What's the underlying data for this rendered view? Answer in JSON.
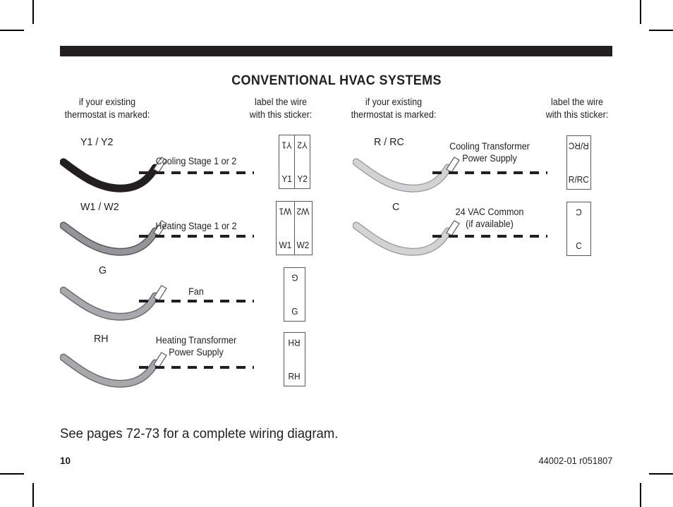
{
  "document": {
    "title": "CONVENTIONAL HVAC SYSTEMS",
    "page_number": "10",
    "doc_code": "44002-01 r051807",
    "footer_note": "See pages 72-73 for a complete wiring diagram."
  },
  "headers": {
    "left_marked": "if your existing\nthermostat is marked:",
    "left_marked_line1": "if your existing",
    "left_marked_line2": "thermostat is marked:",
    "left_sticker_line1": "label the wire",
    "left_sticker_line2": "with this sticker:",
    "right_marked_line1": "if your existing",
    "right_marked_line2": "thermostat is marked:",
    "right_sticker_line1": "label the wire",
    "right_sticker_line2": "with this sticker:"
  },
  "colors": {
    "ink": "#231f20",
    "wire_dark": "#231f20",
    "wire_gray": "#808285",
    "wire_light_gray": "#d1d3d4",
    "sticker_border": "#58595b"
  },
  "rows": [
    {
      "id": "y1y2",
      "terminal": "Y1 / Y2",
      "description_line1": "Cooling Stage 1 or 2",
      "description_line2": "",
      "wire_color": "dark",
      "sticker": {
        "cells": [
          {
            "top": "Y1",
            "bottom": "Y1"
          },
          {
            "top": "Y2",
            "bottom": "Y2"
          }
        ]
      }
    },
    {
      "id": "w1w2",
      "terminal": "W1 / W2",
      "description_line1": "Heating Stage 1 or 2",
      "description_line2": "",
      "wire_color": "gray",
      "sticker": {
        "cells": [
          {
            "top": "W1",
            "bottom": "W1"
          },
          {
            "top": "W2",
            "bottom": "W2"
          }
        ]
      }
    },
    {
      "id": "g",
      "terminal": "G",
      "description_line1": "Fan",
      "description_line2": "",
      "wire_color": "gray",
      "sticker": {
        "cells": [
          {
            "top": "G",
            "bottom": "G"
          }
        ]
      }
    },
    {
      "id": "rh",
      "terminal": "RH",
      "description_line1": "Heating Transformer",
      "description_line2": "Power Supply",
      "wire_color": "gray",
      "sticker": {
        "cells": [
          {
            "top": "RH",
            "bottom": "RH"
          }
        ]
      }
    },
    {
      "id": "rrc",
      "terminal": "R / RC",
      "description_line1": "Cooling Transformer",
      "description_line2": "Power Supply",
      "wire_color": "light",
      "sticker": {
        "cells": [
          {
            "top": "R/RC",
            "bottom": "R/RC"
          }
        ]
      }
    },
    {
      "id": "c",
      "terminal": "C",
      "description_line1": "24 VAC Common",
      "description_line2": "(if available)",
      "wire_color": "light",
      "sticker": {
        "cells": [
          {
            "top": "C",
            "bottom": "C"
          }
        ]
      }
    }
  ]
}
